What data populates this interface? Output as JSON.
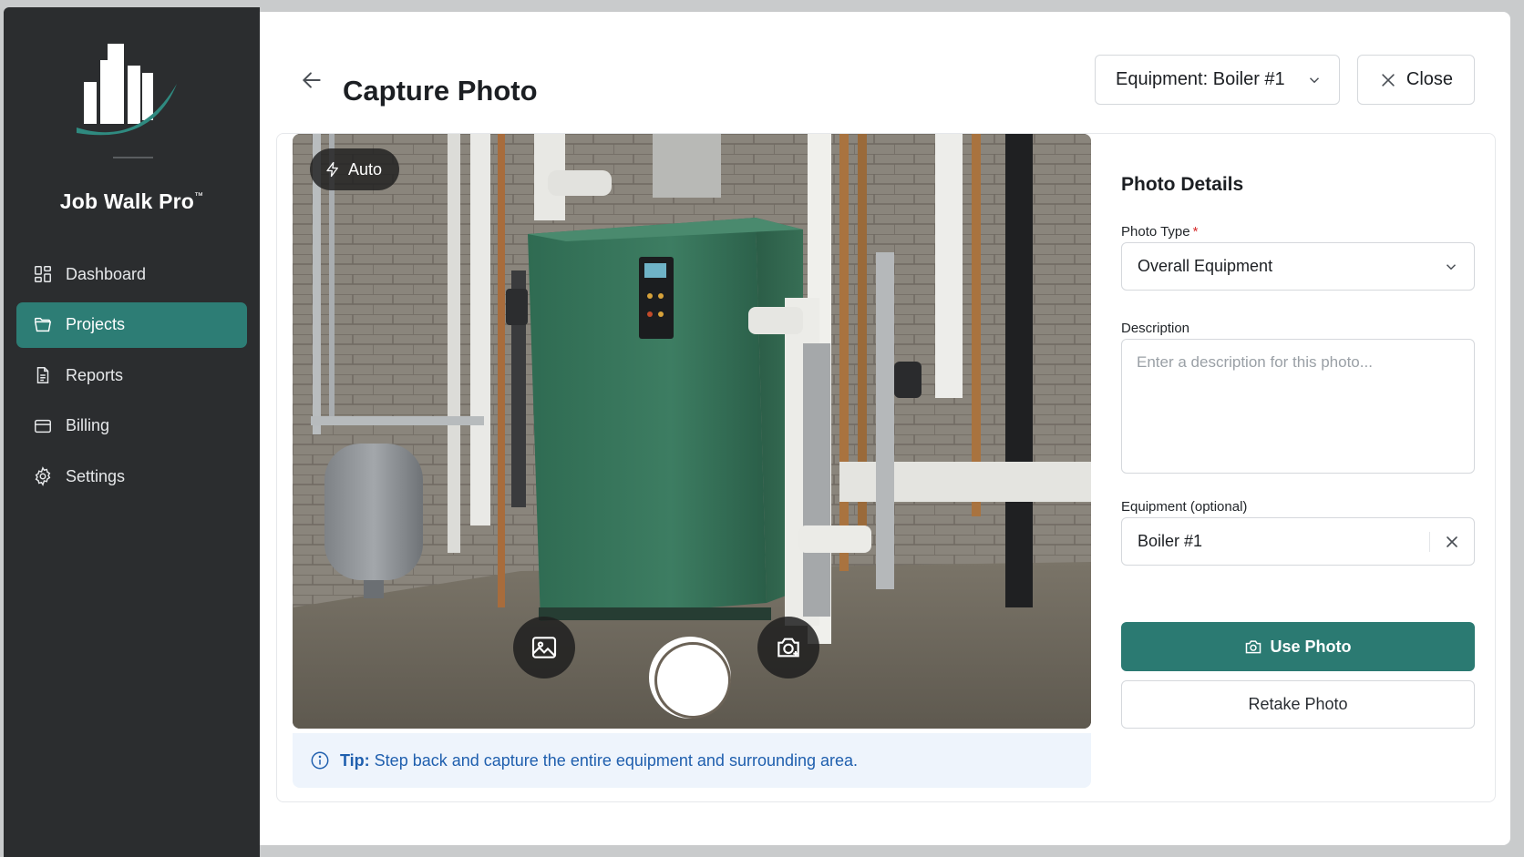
{
  "app": {
    "brand": "Job Walk Pro",
    "trademark": "™"
  },
  "sidebar": {
    "items": [
      {
        "label": "Dashboard",
        "icon": "dashboard-icon",
        "active": false
      },
      {
        "label": "Projects",
        "icon": "folder-icon",
        "active": true
      },
      {
        "label": "Reports",
        "icon": "document-icon",
        "active": false
      },
      {
        "label": "Billing",
        "icon": "credit-card-icon",
        "active": false
      },
      {
        "label": "Settings",
        "icon": "gear-icon",
        "active": false
      }
    ]
  },
  "header": {
    "title": "Capture Photo",
    "equipment_select": "Equipment: Boiler #1",
    "close_label": "Close"
  },
  "camera": {
    "flash_mode": "Auto",
    "subject": "Boiler #1 in a mechanical room"
  },
  "tip": {
    "label": "Tip:",
    "text": "Step back and capture the entire equipment and surrounding area."
  },
  "details": {
    "title": "Photo Details",
    "photo_type_label": "Photo Type",
    "required_mark": "*",
    "photo_type_value": "Overall Equipment",
    "description_label": "Description",
    "description_placeholder": "Enter a description for this photo...",
    "equipment_label": "Equipment (optional)",
    "equipment_value": "Boiler #1",
    "use_photo_label": "Use Photo",
    "retake_label": "Retake Photo"
  },
  "colors": {
    "accent": "#2b7a72",
    "sidebar_bg": "#2b2d2f",
    "tip_text": "#1f5fae",
    "tip_bg": "#eef4fc",
    "required": "#d62b2b"
  }
}
